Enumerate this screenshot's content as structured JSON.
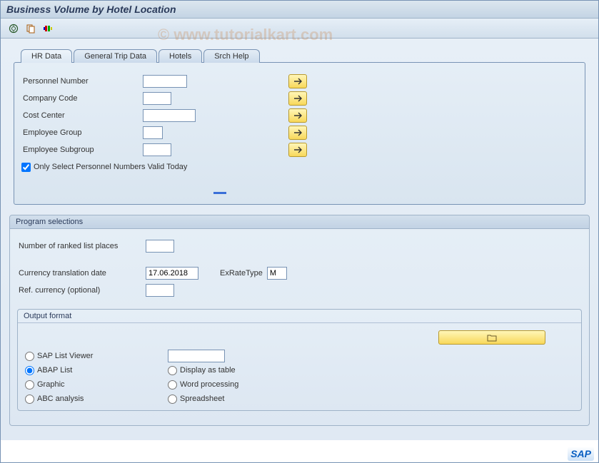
{
  "title": "Business Volume by Hotel Location",
  "watermark": "© www.tutorialkart.com",
  "tabs": [
    {
      "label": "HR Data",
      "active": true
    },
    {
      "label": "General Trip Data",
      "active": false
    },
    {
      "label": "Hotels",
      "active": false
    },
    {
      "label": "Srch Help",
      "active": false
    }
  ],
  "hr_data": {
    "fields": [
      {
        "label": "Personnel Number",
        "value": "",
        "width": "w60"
      },
      {
        "label": "Company Code",
        "value": "",
        "width": "w40"
      },
      {
        "label": "Cost Center",
        "value": "",
        "width": "w70"
      },
      {
        "label": "Employee Group",
        "value": "",
        "width": "w30"
      },
      {
        "label": "Employee Subgroup",
        "value": "",
        "width": "w40"
      }
    ],
    "checkbox_label": "Only Select Personnel Numbers Valid Today",
    "checkbox_checked": true
  },
  "program_selections": {
    "title": "Program selections",
    "ranked_label": "Number of ranked list places",
    "ranked_value": "",
    "curr_date_label": "Currency translation date",
    "curr_date_value": "17.06.2018",
    "exrate_label": "ExRateType",
    "exrate_value": "M",
    "ref_curr_label": "Ref. currency (optional)",
    "ref_curr_value": ""
  },
  "output_format": {
    "title": "Output format",
    "col1": [
      {
        "label": "SAP List Viewer",
        "selected": false,
        "has_input": true
      },
      {
        "label": "ABAP List",
        "selected": true
      },
      {
        "label": "Graphic",
        "selected": false
      },
      {
        "label": "ABC analysis",
        "selected": false
      }
    ],
    "col2": [
      {
        "label": "Display as table",
        "selected": false
      },
      {
        "label": "Word processing",
        "selected": false
      },
      {
        "label": "Spreadsheet",
        "selected": false
      }
    ]
  },
  "logo": "SAP"
}
